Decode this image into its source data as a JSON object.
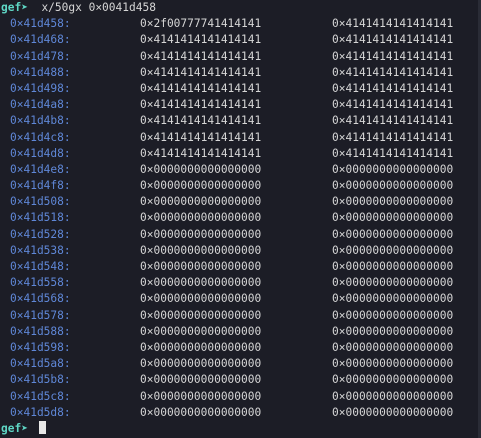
{
  "terminal": {
    "prompt": "gef➤",
    "command": "x/50gx 0×0041d458",
    "final_prompt": "gef➤"
  },
  "memory_rows": [
    {
      "addr": "0×41d458:",
      "v1": "0×2f00777741414141",
      "v2": "0×4141414141414141"
    },
    {
      "addr": "0×41d468:",
      "v1": "0×4141414141414141",
      "v2": "0×4141414141414141"
    },
    {
      "addr": "0×41d478:",
      "v1": "0×4141414141414141",
      "v2": "0×4141414141414141"
    },
    {
      "addr": "0×41d488:",
      "v1": "0×4141414141414141",
      "v2": "0×4141414141414141"
    },
    {
      "addr": "0×41d498:",
      "v1": "0×4141414141414141",
      "v2": "0×4141414141414141"
    },
    {
      "addr": "0×41d4a8:",
      "v1": "0×4141414141414141",
      "v2": "0×4141414141414141"
    },
    {
      "addr": "0×41d4b8:",
      "v1": "0×4141414141414141",
      "v2": "0×4141414141414141"
    },
    {
      "addr": "0×41d4c8:",
      "v1": "0×4141414141414141",
      "v2": "0×4141414141414141"
    },
    {
      "addr": "0×41d4d8:",
      "v1": "0×4141414141414141",
      "v2": "0×4141414141414141"
    },
    {
      "addr": "0×41d4e8:",
      "v1": "0×0000000000000000",
      "v2": "0×0000000000000000"
    },
    {
      "addr": "0×41d4f8:",
      "v1": "0×0000000000000000",
      "v2": "0×0000000000000000"
    },
    {
      "addr": "0×41d508:",
      "v1": "0×0000000000000000",
      "v2": "0×0000000000000000"
    },
    {
      "addr": "0×41d518:",
      "v1": "0×0000000000000000",
      "v2": "0×0000000000000000"
    },
    {
      "addr": "0×41d528:",
      "v1": "0×0000000000000000",
      "v2": "0×0000000000000000"
    },
    {
      "addr": "0×41d538:",
      "v1": "0×0000000000000000",
      "v2": "0×0000000000000000"
    },
    {
      "addr": "0×41d548:",
      "v1": "0×0000000000000000",
      "v2": "0×0000000000000000"
    },
    {
      "addr": "0×41d558:",
      "v1": "0×0000000000000000",
      "v2": "0×0000000000000000"
    },
    {
      "addr": "0×41d568:",
      "v1": "0×0000000000000000",
      "v2": "0×0000000000000000"
    },
    {
      "addr": "0×41d578:",
      "v1": "0×0000000000000000",
      "v2": "0×0000000000000000"
    },
    {
      "addr": "0×41d588:",
      "v1": "0×0000000000000000",
      "v2": "0×0000000000000000"
    },
    {
      "addr": "0×41d598:",
      "v1": "0×0000000000000000",
      "v2": "0×0000000000000000"
    },
    {
      "addr": "0×41d5a8:",
      "v1": "0×0000000000000000",
      "v2": "0×0000000000000000"
    },
    {
      "addr": "0×41d5b8:",
      "v1": "0×0000000000000000",
      "v2": "0×0000000000000000"
    },
    {
      "addr": "0×41d5c8:",
      "v1": "0×0000000000000000",
      "v2": "0×0000000000000000"
    },
    {
      "addr": "0×41d5d8:",
      "v1": "0×0000000000000000",
      "v2": "0×0000000000000000"
    }
  ],
  "colors": {
    "background": "#1c1d26",
    "prompt": "#5fd7c5",
    "address": "#5f87d7",
    "text": "#d6d6d6"
  }
}
